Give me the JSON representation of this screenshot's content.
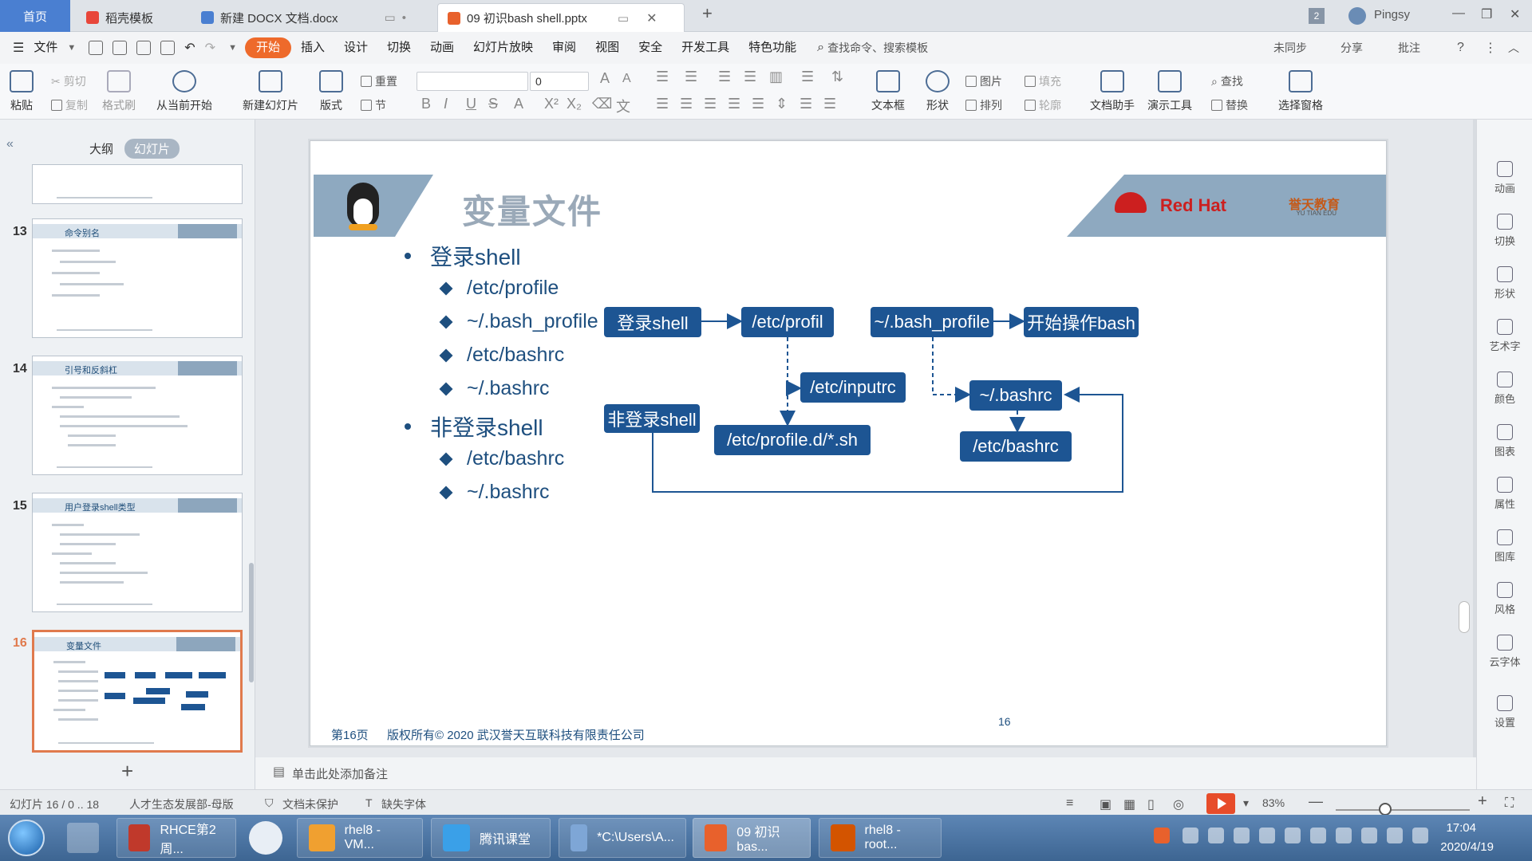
{
  "tabs": [
    {
      "label": "首页"
    },
    {
      "label": "稻壳模板"
    },
    {
      "label": "新建 DOCX 文档.docx"
    },
    {
      "label": "09 初识bash shell.pptx"
    }
  ],
  "user": {
    "name": "Pingsy",
    "badge": "2"
  },
  "menu": {
    "file": "文件",
    "items": [
      "开始",
      "插入",
      "设计",
      "切换",
      "动画",
      "幻灯片放映",
      "审阅",
      "视图",
      "安全",
      "开发工具",
      "特色功能"
    ],
    "search": "查找命令、搜索模板",
    "right": [
      "未同步",
      "分享",
      "批注"
    ]
  },
  "ribbon": {
    "paste": "粘贴",
    "cut": "剪切",
    "copy": "复制",
    "format_painter": "格式刷",
    "from_current": "从当前开始",
    "new_slide": "新建幻灯片",
    "layout": "版式",
    "reset": "重置",
    "section": "节",
    "font_size": "0",
    "textbox": "文本框",
    "shape": "形状",
    "picture": "图片",
    "fill": "填充",
    "arrange": "排列",
    "outline": "轮廓",
    "doc_assistant": "文档助手",
    "presenter_tools": "演示工具",
    "find": "查找",
    "replace": "替换",
    "selection_pane": "选择窗格"
  },
  "left_panel": {
    "tab_outline": "大纲",
    "tab_slides": "幻灯片",
    "thumbnails": [
      {
        "num": "13",
        "title": "命令别名"
      },
      {
        "num": "14",
        "title": "引号和反斜杠"
      },
      {
        "num": "15",
        "title": "用户登录shell类型"
      },
      {
        "num": "16",
        "title": "变量文件"
      }
    ],
    "add": "+"
  },
  "slide": {
    "title": "变量文件",
    "logo_redhat": "Red Hat",
    "logo_yutian": "誉天教育",
    "logo_yutian_sub": "YU TIAN EDU",
    "bullets": [
      {
        "label": "登录shell",
        "items": [
          "/etc/profile",
          "~/.bash_profile",
          "/etc/bashrc",
          "~/.bashrc"
        ]
      },
      {
        "label": "非登录shell",
        "items": [
          "/etc/bashrc",
          "~/.bashrc"
        ]
      }
    ],
    "diagram": {
      "login_shell": "登录shell",
      "etc_profil": "/etc/profil",
      "bash_profile": "~/.bash_profile",
      "start_bash": "开始操作bash",
      "inputrc": "/etc/inputrc",
      "non_login": "非登录shell",
      "profile_d": "/etc/profile.d/*.sh",
      "bashrc_home": "~/.bashrc",
      "etc_bashrc": "/etc/bashrc"
    },
    "footer_page": "第16页",
    "footer_copy": "版权所有© 2020 武汉誉天互联科技有限责任公司",
    "number": "16"
  },
  "notes_placeholder": "单击此处添加备注",
  "right_panel": [
    "动画",
    "切换",
    "形状",
    "艺术字",
    "颜色",
    "图表",
    "属性",
    "图库",
    "风格",
    "云字体",
    "设置"
  ],
  "status": {
    "slide_pos": "幻灯片 16 / 0 .. 18",
    "template": "人才生态发展部-母版",
    "doc_protect": "文档未保护",
    "missing_font": "缺失字体",
    "zoom": "83%"
  },
  "taskbar": {
    "items": [
      "RHCE第2周...",
      "rhel8 - VM...",
      "腾讯课堂",
      "*C:\\Users\\A...",
      "09 初识bas...",
      "rhel8 - root..."
    ],
    "time": "17:04",
    "date": "2020/4/19"
  },
  "colors": {
    "accent": "#ee6a2b",
    "node": "#1d5593",
    "banner": "#8ea9c0"
  }
}
